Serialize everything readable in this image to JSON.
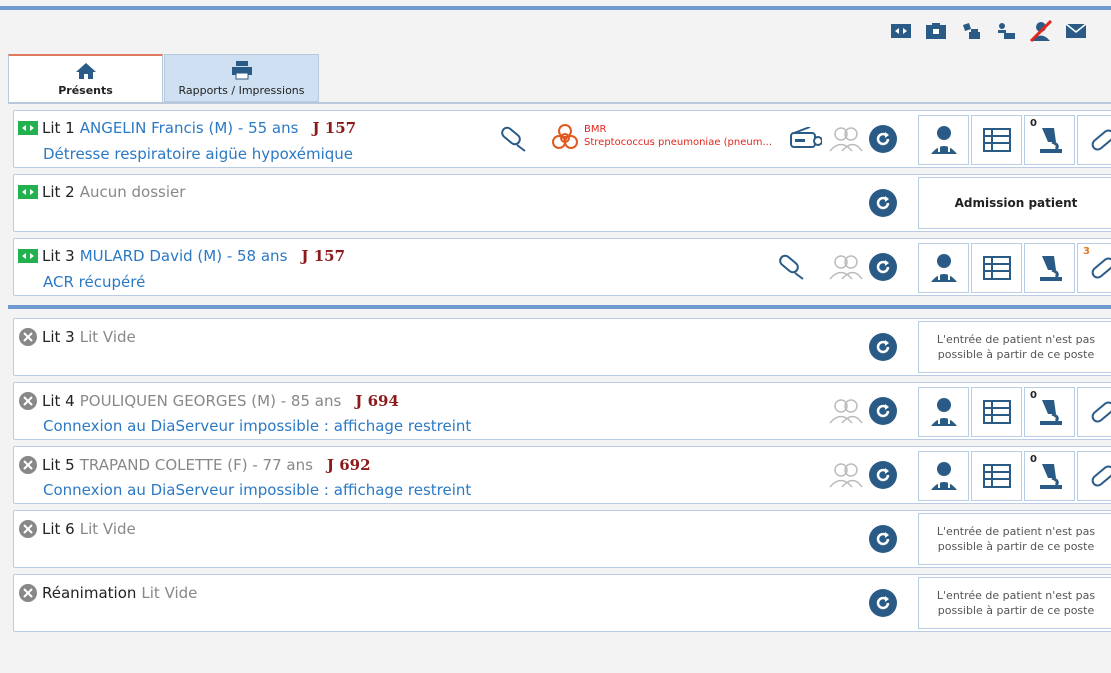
{
  "toolbar": {
    "icons": [
      "transfer-icon",
      "folder-icon",
      "print-label-icon",
      "print-bracelet-icon",
      "no-user-icon",
      "mail-icon"
    ]
  },
  "tabs": [
    {
      "label": "Présents",
      "icon": "home-icon",
      "active": true
    },
    {
      "label": "Rapports / Impressions",
      "icon": "printer-icon",
      "active": false
    }
  ],
  "beds": [
    {
      "status": "active",
      "bed": "Lit 1",
      "patient": "ANGELIN Francis (M) - 55 ans",
      "day": "J 157",
      "diagnosis": "Détresse respiratoire aigüe hypoxémique",
      "alert_title": "BMR",
      "alert_text": "Streptococcus pneumoniae (pneum...",
      "counts": [
        "",
        "",
        "0",
        ""
      ]
    },
    {
      "status": "active",
      "bed": "Lit 2",
      "patient": "Aucun dossier",
      "day": "",
      "diagnosis": "",
      "action": "Admission patient"
    },
    {
      "status": "active",
      "bed": "Lit 3",
      "patient": "MULARD David (M) - 58 ans",
      "day": "J 157",
      "diagnosis": "ACR récupéré",
      "counts": [
        "",
        "",
        "",
        "3"
      ]
    },
    {
      "status": "offline",
      "bed": "Lit 3",
      "patient": "Lit Vide",
      "day": "",
      "diagnosis": "",
      "message": "L'entrée de patient n'est pas possible à partir de ce poste"
    },
    {
      "status": "offline",
      "bed": "Lit 4",
      "patient": "POULIQUEN GEORGES (M) - 85 ans",
      "day": "J 694",
      "diagnosis": "Connexion au DiaServeur impossible : affichage restreint",
      "counts": [
        "",
        "",
        "0",
        ""
      ]
    },
    {
      "status": "offline",
      "bed": "Lit 5",
      "patient": "TRAPAND COLETTE (F) - 77 ans",
      "day": "J 692",
      "diagnosis": "Connexion au DiaServeur impossible : affichage restreint",
      "counts": [
        "",
        "",
        "0",
        ""
      ]
    },
    {
      "status": "offline",
      "bed": "Lit 6",
      "patient": "Lit Vide",
      "day": "",
      "diagnosis": "",
      "message": "L'entrée de patient n'est pas possible à partir de ce poste"
    },
    {
      "status": "offline",
      "bed": "Réanimation",
      "patient": "Lit Vide",
      "day": "",
      "diagnosis": "",
      "message": "L'entrée de patient n'est pas possible à partir de ce poste"
    }
  ],
  "colors": {
    "accent": "#2b79c4",
    "day": "#8b1a1a",
    "alert": "#e0261e",
    "active_bed": "#22b14c"
  }
}
